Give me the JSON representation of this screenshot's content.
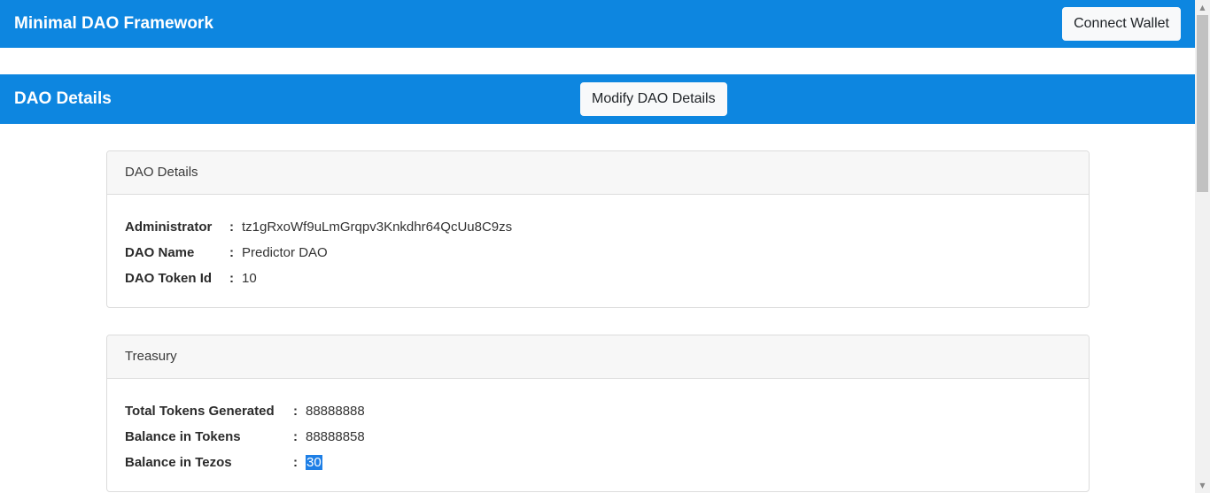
{
  "navbar": {
    "brand": "Minimal DAO Framework",
    "connect_label": "Connect Wallet"
  },
  "section": {
    "title": "DAO Details",
    "modify_label": "Modify DAO Details"
  },
  "details_card": {
    "header": "DAO Details",
    "rows": [
      {
        "label": "Administrator",
        "value": "tz1gRxoWf9uLmGrqpv3Knkdhr64QcUu8C9zs"
      },
      {
        "label": "DAO Name",
        "value": "Predictor DAO"
      },
      {
        "label": "DAO Token Id",
        "value": "10"
      }
    ]
  },
  "treasury_card": {
    "header": "Treasury",
    "rows": [
      {
        "label": "Total Tokens Generated",
        "value": "88888888"
      },
      {
        "label": "Balance in Tokens",
        "value": "88888858"
      },
      {
        "label": "Balance in Tezos",
        "value": "30"
      }
    ]
  },
  "separator": ":",
  "colors": {
    "primary": "#0d86e0",
    "selection": "#1e7fe6"
  }
}
